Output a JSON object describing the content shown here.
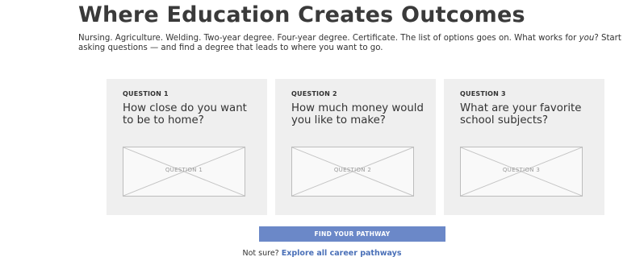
{
  "header": {
    "title": "Where Education Creates Outcomes",
    "intro_part1": "Nursing. Agriculture. Welding. Two-year degree. Four-year degree. Certificate. The list of options goes on. What works for ",
    "intro_emphasis": "you",
    "intro_part2": "? Start asking questions — and find a degree that leads to where you want to go."
  },
  "questions": [
    {
      "label": "QUESTION 1",
      "text": "How close do you want to be to home?",
      "image_placeholder": "QUESTION 1"
    },
    {
      "label": "QUESTION 2",
      "text": "How much money would you like to make?",
      "image_placeholder": "QUESTION 2"
    },
    {
      "label": "QUESTION 3",
      "text": "What are your favorite school subjects?",
      "image_placeholder": "QUESTION 3"
    }
  ],
  "cta": {
    "label": "FIND YOUR PATHWAY"
  },
  "footer": {
    "prompt": "Not sure?",
    "link_label": "Explore all career pathways"
  },
  "colors": {
    "button": "#6b88c8",
    "link": "#4a70b8",
    "card_bg": "#efefef"
  }
}
